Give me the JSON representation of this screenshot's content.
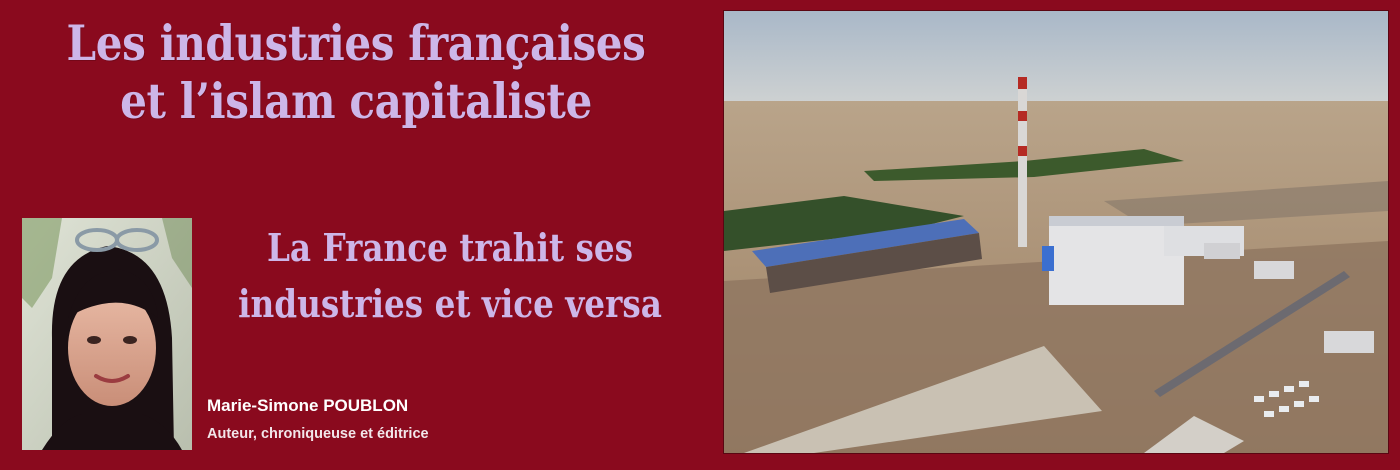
{
  "banner": {
    "title_lines": [
      "Les industries françaises",
      "et l’islam capitaliste"
    ],
    "subtitle_lines": [
      "La France trahit ses",
      "industries et vice versa"
    ],
    "author": {
      "name": "Marie-Simone POUBLON",
      "role": "Auteur, chroniqueuse et éditrice"
    },
    "colors": {
      "background": "#8a0a1e",
      "title_text": "#cdb6e8",
      "author_text": "#ffffff"
    },
    "images": {
      "portrait": "author-portrait-photo",
      "aerial": "industrial-plant-aerial-photo"
    }
  }
}
